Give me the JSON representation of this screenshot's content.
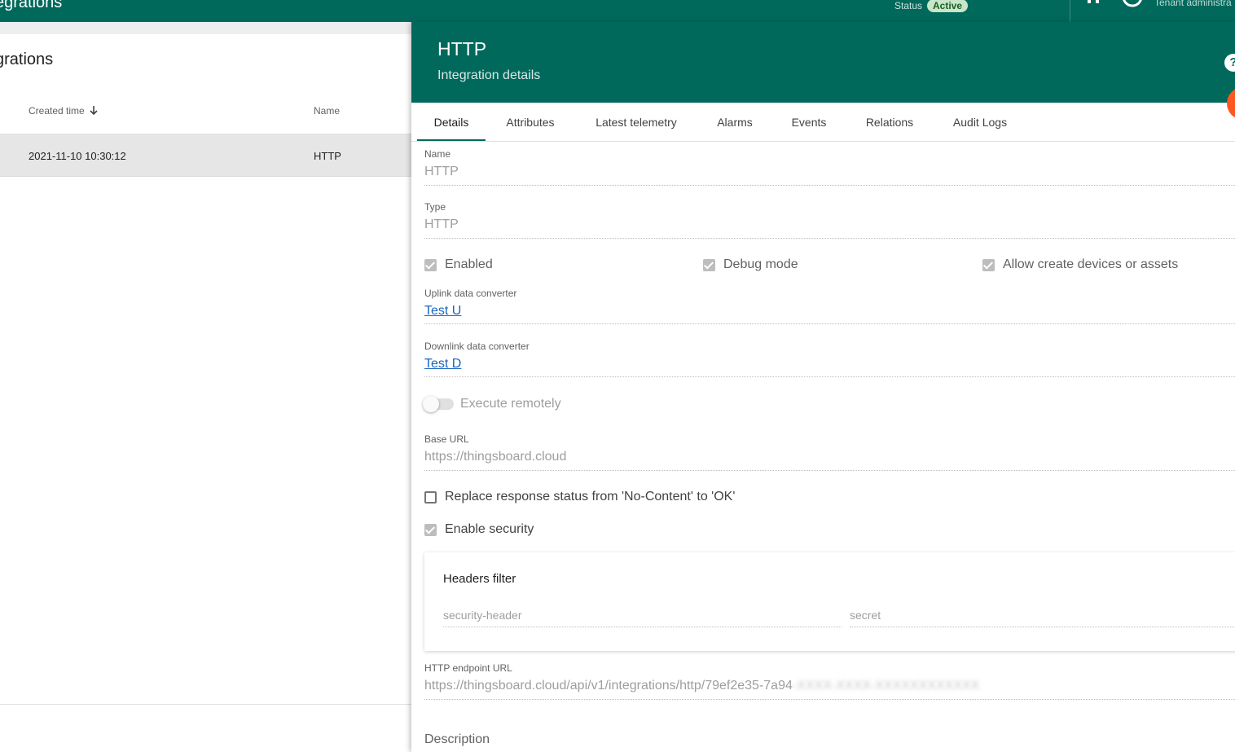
{
  "topbar": {
    "title": "egrations",
    "status_label": "Status",
    "status_value": "Active",
    "user_role": "Tenant administra",
    "color": "#00695c"
  },
  "list": {
    "title": "grations",
    "columns": {
      "created": "Created time",
      "name": "Name"
    },
    "rows": [
      {
        "created": "2021-11-10 10:30:12",
        "name": "HTTP"
      }
    ]
  },
  "details": {
    "title": "HTTP",
    "subtitle": "Integration details",
    "tabs": [
      {
        "label": "Details",
        "active": true
      },
      {
        "label": "Attributes"
      },
      {
        "label": "Latest telemetry"
      },
      {
        "label": "Alarms"
      },
      {
        "label": "Events"
      },
      {
        "label": "Relations"
      },
      {
        "label": "Audit Logs"
      }
    ],
    "name": {
      "label": "Name",
      "value": "HTTP"
    },
    "type": {
      "label": "Type",
      "value": "HTTP"
    },
    "checkboxes": {
      "enabled": {
        "label": "Enabled",
        "checked": true
      },
      "debug": {
        "label": "Debug mode",
        "checked": true
      },
      "allow_create": {
        "label": "Allow create devices or assets",
        "checked": true
      }
    },
    "uplink": {
      "label": "Uplink data converter",
      "value": "Test U"
    },
    "downlink": {
      "label": "Downlink data converter",
      "value": "Test D"
    },
    "execute_remotely": {
      "label": "Execute remotely",
      "on": false
    },
    "base_url": {
      "label": "Base URL",
      "value": "https://thingsboard.cloud"
    },
    "replace_status": {
      "label": "Replace response status from 'No-Content' to 'OK'",
      "checked": false
    },
    "enable_security": {
      "label": "Enable security",
      "checked": true
    },
    "headers_filter": {
      "title": "Headers filter",
      "key_placeholder": "security-header",
      "value_placeholder": "secret"
    },
    "endpoint": {
      "label": "HTTP endpoint URL",
      "value": "https://thingsboard.cloud/api/v1/integrations/http/79ef2e35-7a94",
      "blurred_tail": "-XXXX-XXXX-XXXXXXXXXXXX"
    },
    "description_label": "Description"
  }
}
